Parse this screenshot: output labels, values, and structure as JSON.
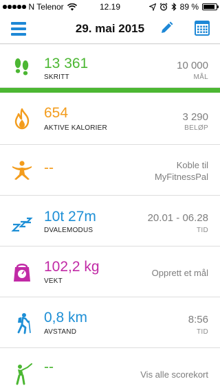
{
  "status_bar": {
    "carrier": "N Telenor",
    "time": "12.19",
    "battery": "89 %"
  },
  "header": {
    "date": "29. mai 2015",
    "menu_icon": "hamburger-menu-icon",
    "edit_icon": "pencil-icon",
    "calendar_icon": "calendar-grid-icon"
  },
  "colors": {
    "accent": "#1e88d6",
    "steps": "#4cb733",
    "calories": "#f39c1c",
    "myfitnesspal": "#f39c1c",
    "sleep": "#1e8fd6",
    "weight": "#c12aa6",
    "distance": "#1e8fd6",
    "golf": "#4cb733"
  },
  "rows": {
    "steps": {
      "value": "13 361",
      "label": "SKRITT",
      "right_value": "10 000",
      "right_label": "MÅL",
      "progress": 1.0
    },
    "calories": {
      "value": "654",
      "label": "AKTIVE KALORIER",
      "right_value": "3 290",
      "right_label": "BELØP"
    },
    "myfitnesspal": {
      "value": "--",
      "right_line1": "Koble til",
      "right_line2": "MyFitnessPal"
    },
    "sleep": {
      "value": "10t 27m",
      "label": "DVALEMODUS",
      "right_value": "20.01 - 06.28",
      "right_label": "TID"
    },
    "weight": {
      "value": "102,2 kg",
      "label": "VEKT",
      "right_text": "Opprett et mål"
    },
    "distance": {
      "value": "0,8 km",
      "label": "AVSTAND",
      "right_value": "8:56",
      "right_label": "TID"
    },
    "golf": {
      "value": "--",
      "right_text": "Vis alle scorekort"
    }
  }
}
